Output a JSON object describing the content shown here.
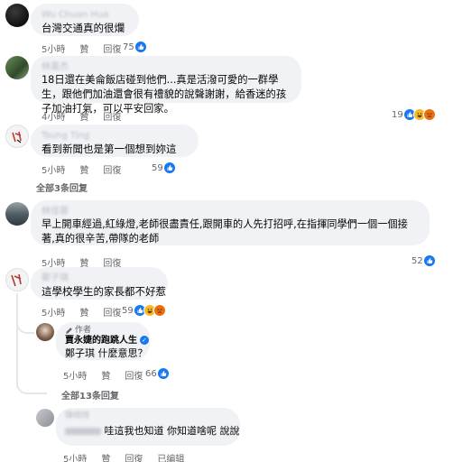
{
  "comments": [
    {
      "name": "Wu Chuan Hua",
      "text": "台灣交通真的很爛",
      "time": "5小時",
      "like": "贊",
      "reply": "回復",
      "reaction_count": "75",
      "reactions": [
        "like"
      ]
    },
    {
      "name": "林嘉杰",
      "text": "18日還在美侖飯店碰到他們...真是活潑可愛的一群學生，跟他們加油還會很有禮貌的說聲謝謝，給香迷的孩子加油打氣，可以平安回家。",
      "time": "4小時",
      "like": "贊",
      "reply": "回復",
      "reaction_count": "19",
      "reactions": [
        "like",
        "haha",
        "angry"
      ]
    },
    {
      "name": "Tsung Ting",
      "text": "看到新聞也是第一個想到妳這",
      "time": "5小時",
      "like": "贊",
      "reply": "回復",
      "reaction_count": "59",
      "reactions": [
        "like"
      ],
      "more_replies": "全部3条回复"
    },
    {
      "name": "林佳蓉",
      "text": "早上開車經過,紅綠燈,老師很盡責任,跟開車的人先打招呼,在指揮同學們一個一個接著,真的很辛苦,帶隊的老師",
      "time": "5小時",
      "like": "贊",
      "reply": "回復",
      "reaction_count": "52",
      "reactions": [
        "like"
      ]
    },
    {
      "name": "鄭子琪",
      "text": "這學校學生的家長都不好惹",
      "time": "5小時",
      "like": "贊",
      "reply": "回復",
      "reaction_count": "59",
      "reactions": [
        "like",
        "haha",
        "angry"
      ]
    }
  ],
  "author_reply": {
    "author_tag": "作者",
    "name": "賈永婕的跑跳人生",
    "mention": "鄭子琪",
    "text": "什麼意思？",
    "time": "5小時",
    "like": "贊",
    "reply": "回復",
    "reaction_count": "66",
    "reactions": [
      "like"
    ]
  },
  "all_replies": "全部13条回复",
  "last_reply": {
    "name": "陳晴晴",
    "text": "哇這我也知道 你知道啥呢 說說",
    "time": "5小時",
    "like": "贊",
    "reply": "回復",
    "edited": "已编辑"
  },
  "colors": {
    "bubble": "#f0f2f5",
    "like_blue": "#1877f2",
    "meta_gray": "#65676b"
  }
}
